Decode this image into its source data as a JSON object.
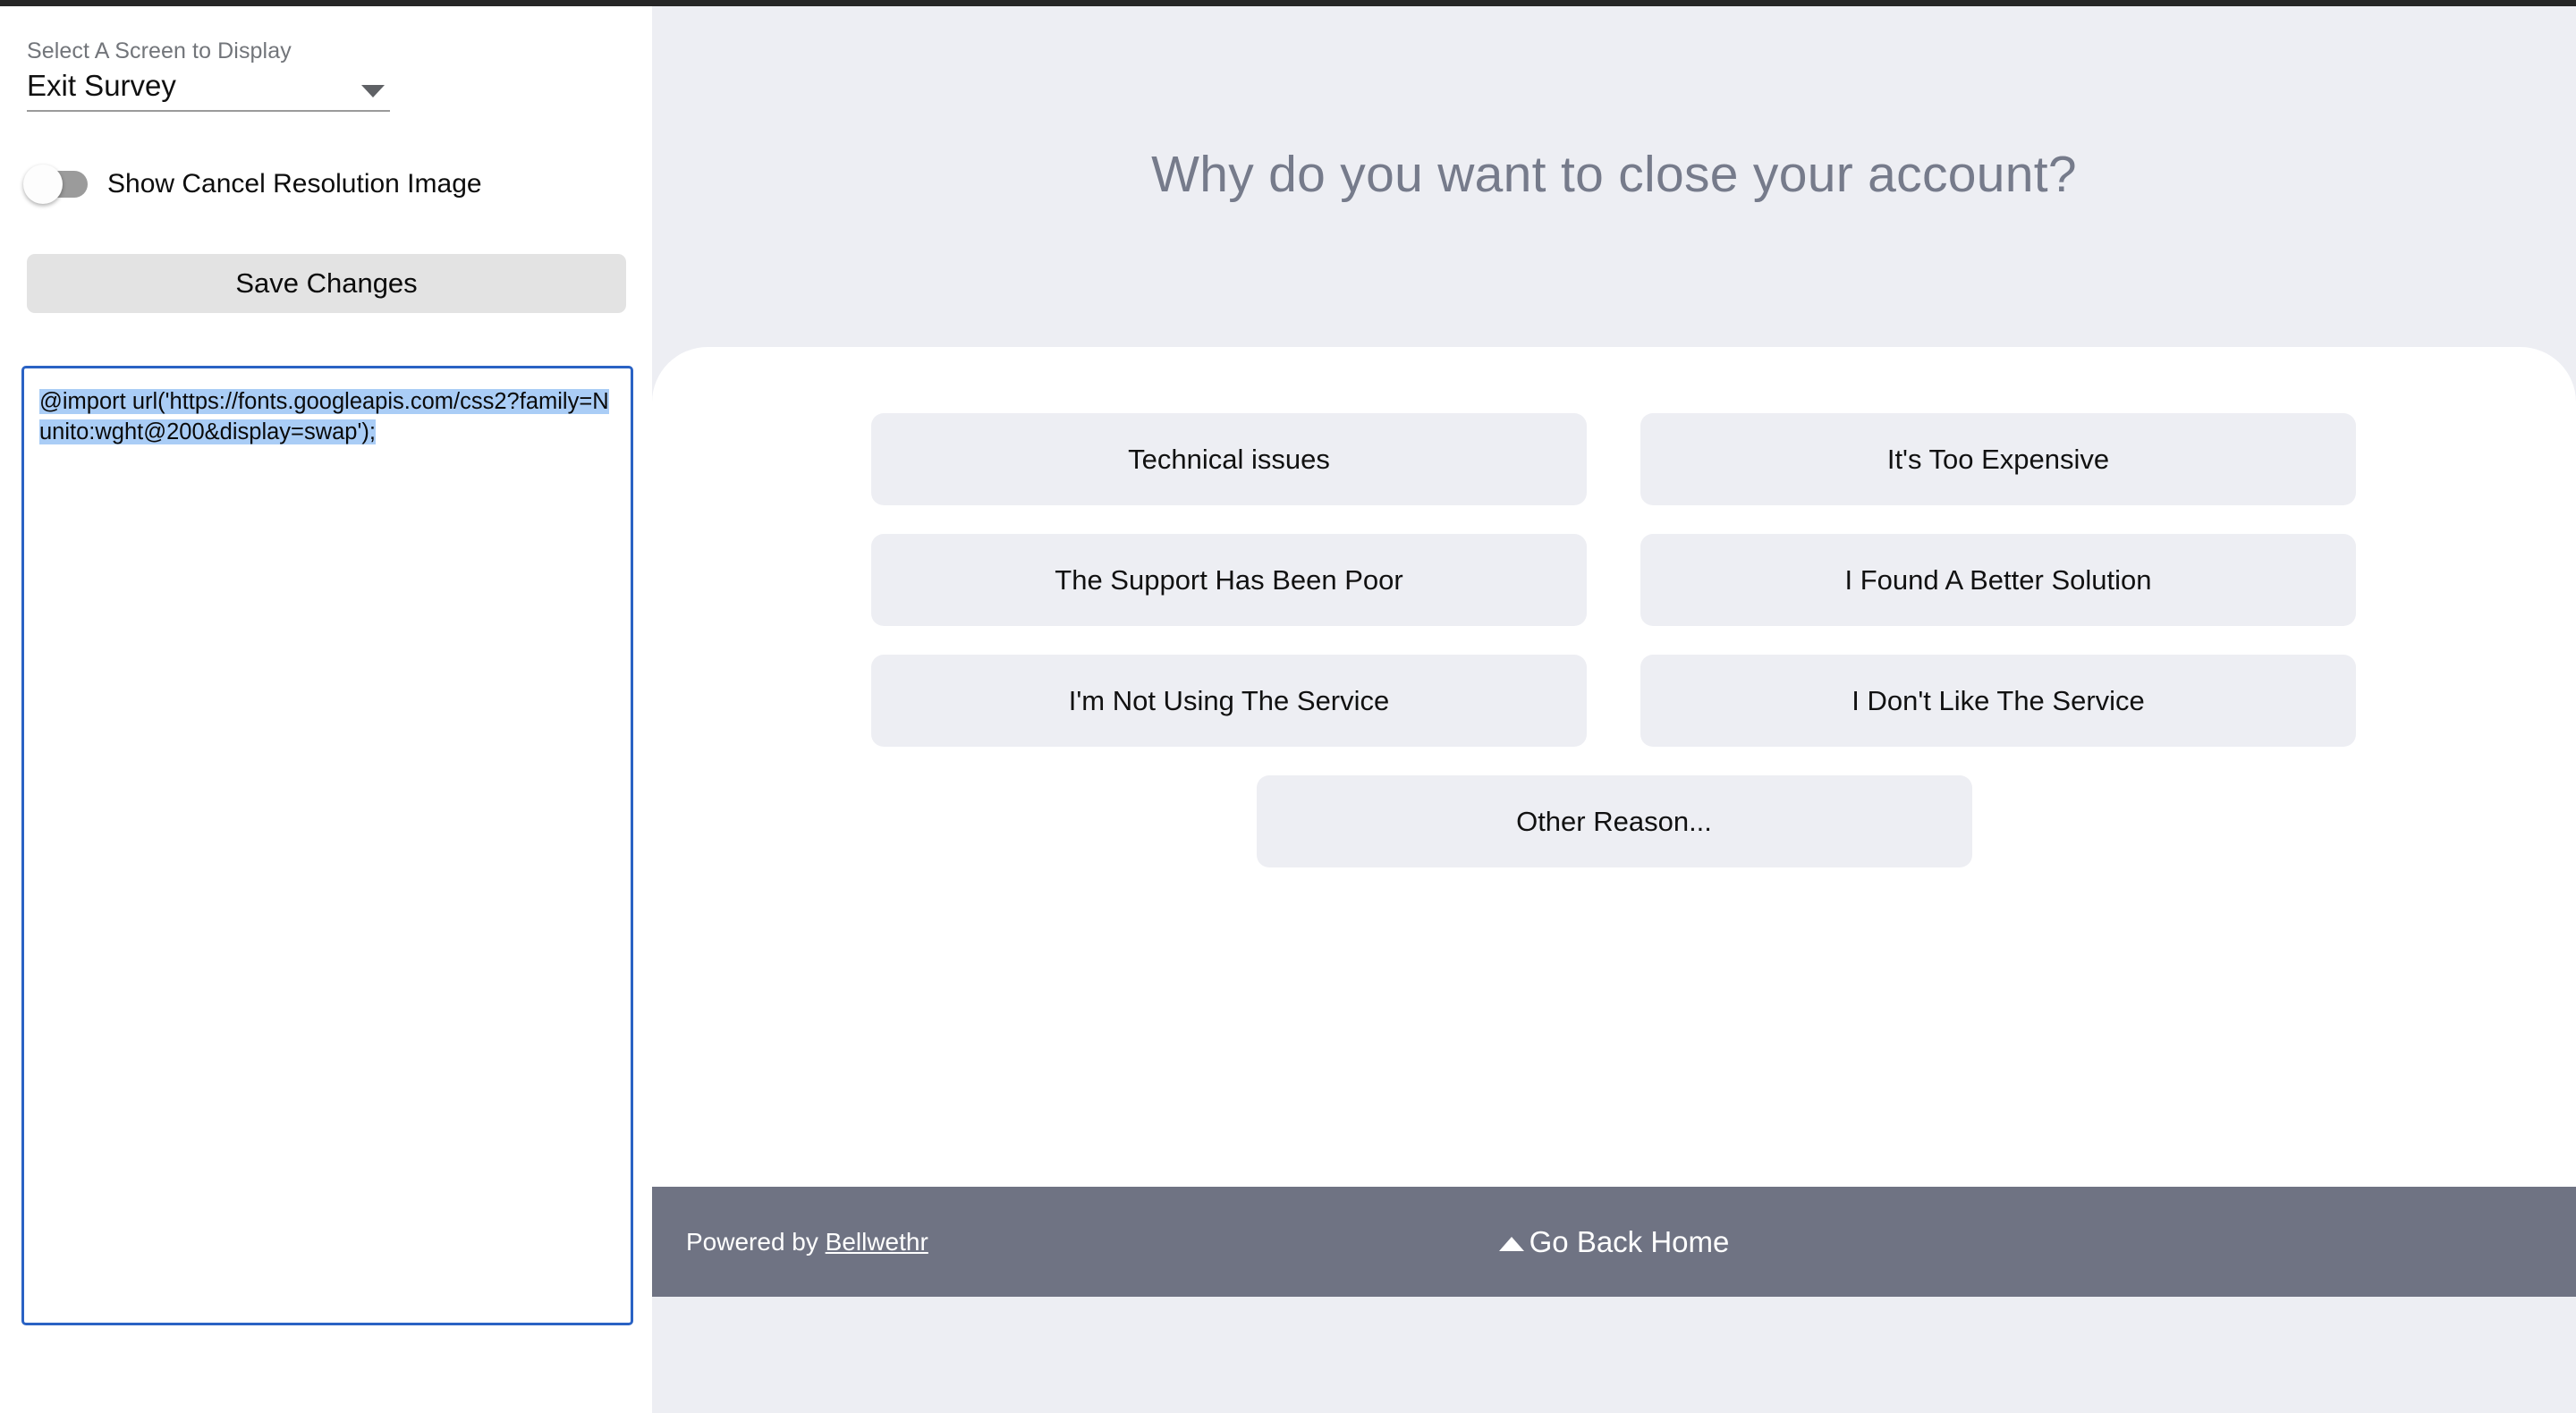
{
  "window": {
    "top_strip_color": "#262626"
  },
  "config_panel": {
    "screen_select": {
      "label": "Select A Screen to Display",
      "value": "Exit Survey",
      "caret_icon": "chevron-down-icon"
    },
    "toggle": {
      "label": "Show Cancel Resolution Image",
      "state": "off"
    },
    "save_button": {
      "label": "Save Changes"
    },
    "code_editor": {
      "selected_text": "@import url('https://fonts.googleapis.com/css2?family=Nunito:wght@200&display=swap');",
      "selection_color": "#aacdf6",
      "border_color": "#2a62c4"
    }
  },
  "preview": {
    "background_color": "#edeef3",
    "card_color": "#ffffff",
    "title": "Why do you want to close your account?",
    "title_color": "#767b8b",
    "options": [
      "Technical issues",
      "It's Too Expensive",
      "The Support Has Been Poor",
      "I Found A Better Solution",
      "I'm Not Using The Service",
      "I Don't Like The Service"
    ],
    "last_option": "Other Reason...",
    "footer": {
      "background_color": "#6f7383",
      "powered_prefix": "Powered by ",
      "brand": "Bellwethr",
      "back_home_label": "Go Back Home",
      "back_home_icon": "caret-up-icon"
    }
  }
}
